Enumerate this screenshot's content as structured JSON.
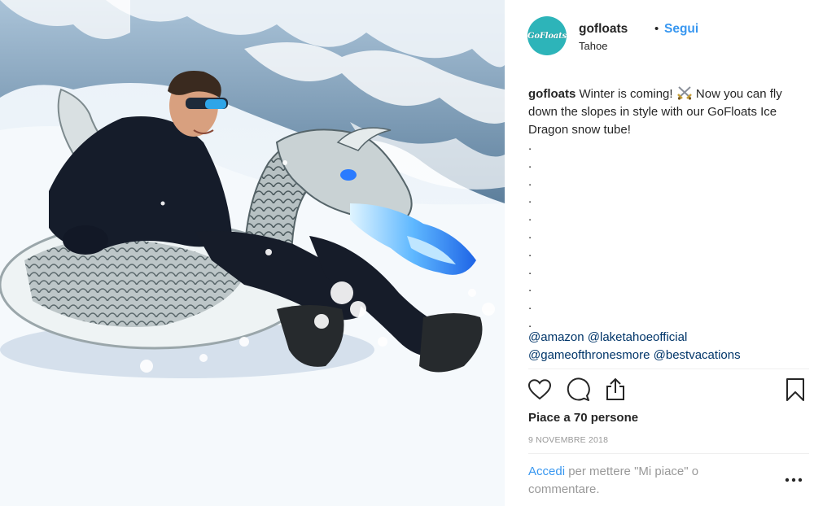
{
  "post": {
    "username": "gofloats",
    "separator": "•",
    "follow_label": "Segui",
    "location": "Tahoe",
    "avatar_text": "GoFloats"
  },
  "caption": {
    "username": "gofloats",
    "text_before_emoji": "Winter is coming!",
    "emoji_icon": "crossed-swords-icon",
    "text_after_emoji": "Now you can fly down the slopes in style with our GoFloats Ice Dragon snow tube!",
    "dots": [
      ".",
      ".",
      ".",
      ".",
      ".",
      ".",
      ".",
      ".",
      ".",
      ".",
      "."
    ],
    "mentions": [
      "@amazon",
      "@laketahoeofficial",
      "@gameofthronesmore",
      "@bestvacations"
    ]
  },
  "actions": {
    "icons": [
      "heart-icon",
      "comment-icon",
      "share-icon",
      "bookmark-icon"
    ]
  },
  "likes": "Piace a 70 persone",
  "date": "9 NOVEMBRE 2018",
  "login_prompt": {
    "link": "Accedi",
    "text": "per mettere \"Mi piace\" o commentare."
  },
  "more_icon": "more-options-icon",
  "colors": {
    "accent_link": "#3897f0",
    "mention": "#003569",
    "muted": "#999999",
    "avatar_bg": "#2db4b9",
    "text": "#262626"
  }
}
